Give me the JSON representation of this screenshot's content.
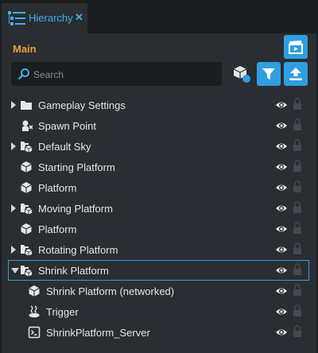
{
  "tab": {
    "title": "Hierarchy",
    "close": "✕"
  },
  "panel": {
    "title": "Main"
  },
  "search": {
    "placeholder": "Search",
    "value": ""
  },
  "accent": "#2f9fe0",
  "items": [
    {
      "label": "Gameplay Settings",
      "icon": "folder-icon",
      "depth": 0,
      "expander": "closed"
    },
    {
      "label": "Spawn Point",
      "icon": "spawn-point-icon",
      "depth": 0,
      "expander": "none"
    },
    {
      "label": "Default Sky",
      "icon": "folder-model-icon",
      "depth": 0,
      "expander": "closed"
    },
    {
      "label": "Starting Platform",
      "icon": "cube-icon",
      "depth": 0,
      "expander": "none"
    },
    {
      "label": "Platform",
      "icon": "cube-icon",
      "depth": 0,
      "expander": "none"
    },
    {
      "label": "Moving Platform",
      "icon": "folder-model-icon",
      "depth": 0,
      "expander": "closed"
    },
    {
      "label": "Platform",
      "icon": "cube-icon",
      "depth": 0,
      "expander": "none"
    },
    {
      "label": "Rotating Platform",
      "icon": "folder-model-icon",
      "depth": 0,
      "expander": "closed"
    },
    {
      "label": "Shrink Platform",
      "icon": "folder-model-icon",
      "depth": 0,
      "expander": "open",
      "selected": true
    },
    {
      "label": "Shrink Platform (networked)",
      "icon": "cube-icon",
      "depth": 1,
      "expander": "none"
    },
    {
      "label": "Trigger",
      "icon": "trigger-icon",
      "depth": 1,
      "expander": "none"
    },
    {
      "label": "ShrinkPlatform_Server",
      "icon": "script-icon",
      "depth": 1,
      "expander": "none"
    }
  ]
}
